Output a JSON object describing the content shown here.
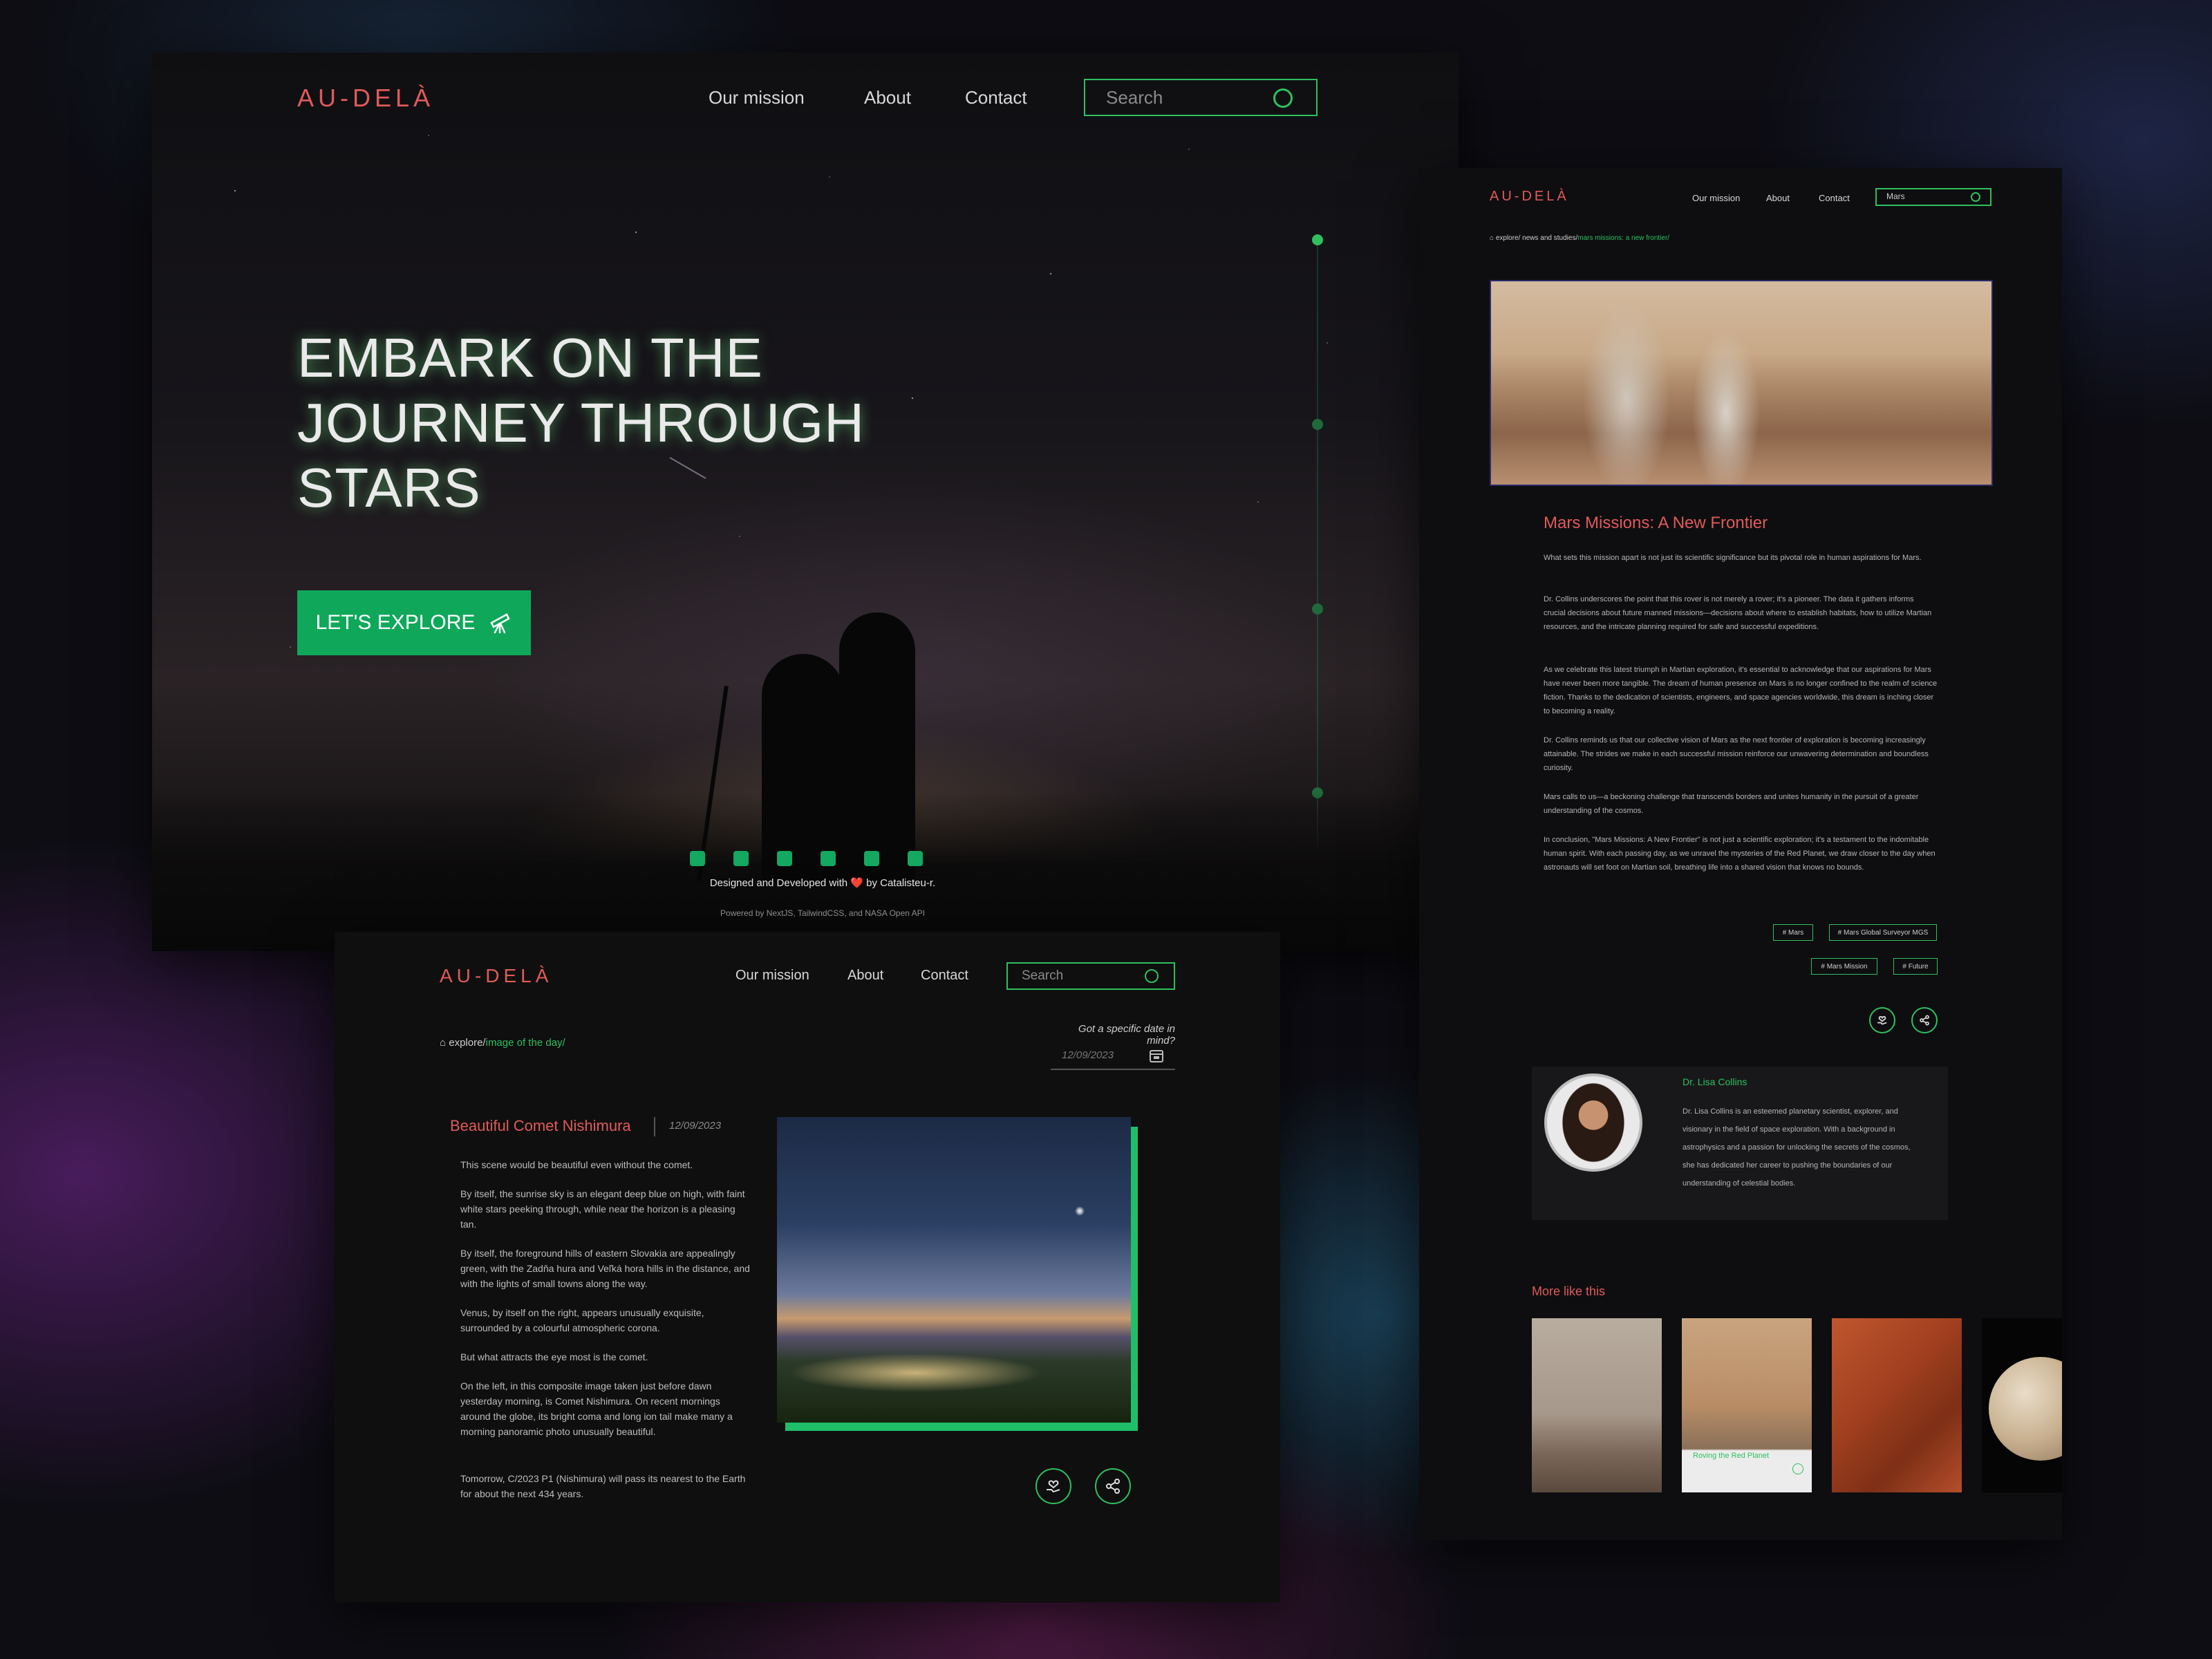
{
  "brand": "AU-DELÀ",
  "nav": [
    "Our mission",
    "About",
    "Contact"
  ],
  "hero": {
    "search_placeholder": "Search",
    "title": "EMBARK ON THE JOURNEY THROUGH STARS",
    "cta_label": "LET'S EXPLORE",
    "footer_line1": "Designed and Developed with ❤️ by Catalisteu-r.",
    "footer_line2": "Powered by NextJS, TailwindCSS, and NASA Open API",
    "social_icons": [
      "linkedin-icon",
      "github-icon",
      "dribbble-icon",
      "instagram-icon",
      "twitter-icon",
      "tumblr-icon"
    ]
  },
  "apod": {
    "search_placeholder": "Search",
    "breadcrumb_root": "explore/",
    "breadcrumb_current": "image of the day/",
    "date_prompt": "Got a specific date in mind?",
    "date_value": "12/09/2023",
    "post_title": "Beautiful Comet Nishimura",
    "post_date": "12/09/2023",
    "paragraphs": [
      "This scene would be beautiful even without the comet.",
      "By itself, the sunrise sky is an elegant deep blue on high, with faint white stars peeking through, while near the horizon is a pleasing tan.",
      "By itself, the foreground hills of eastern Slovakia are appealingly green, with the Zadňa hura and Veľká hora hills in the distance, and with the lights of small towns along the way.",
      "Venus, by itself on the right, appears unusually exquisite, surrounded by a colourful atmospheric corona.",
      "But what attracts the eye most is the comet.",
      "On the left, in this composite image taken just before dawn yesterday morning, is Comet Nishimura. On recent mornings around the globe, its bright coma and long ion tail make many a morning panoramic photo unusually beautiful.",
      "Tomorrow, C/2023 P1 (Nishimura) will pass its nearest to the Earth for about the next 434 years."
    ]
  },
  "article": {
    "search_value": "Mars",
    "breadcrumb_root": "explore/ news and studies/",
    "breadcrumb_current": "mars missions: a new frontier/",
    "title": "Mars Missions: A New Frontier",
    "paragraphs": [
      "What sets this mission apart is not just its scientific significance but its pivotal role in human aspirations for Mars.",
      "Dr. Collins underscores the point that this rover is not merely a rover; it's a pioneer. The data it gathers informs crucial decisions about future manned missions—decisions about where to establish habitats, how to utilize Martian resources, and the intricate planning required for safe and successful expeditions.",
      "As we celebrate this latest triumph in Martian exploration, it's essential to acknowledge that our aspirations for Mars have never been more tangible. The dream of human presence on Mars is no longer confined to the realm of science fiction. Thanks to the dedication of scientists, engineers, and space agencies worldwide, this dream is inching closer to becoming a reality.",
      "Dr. Collins reminds us that our collective vision of Mars as the next frontier of exploration is becoming increasingly attainable. The strides we make in each successful mission reinforce our unwavering determination and boundless curiosity.",
      "Mars calls to us—a beckoning challenge that transcends borders and unites humanity in the pursuit of a greater understanding of the cosmos.",
      "In conclusion, \"Mars Missions: A New Frontier\" is not just a scientific exploration; it's a testament to the indomitable human spirit. With each passing day, as we unravel the mysteries of the Red Planet, we draw closer to the day when astronauts will set foot on Martian soil, breathing life into a shared vision that knows no bounds."
    ],
    "tags": [
      "# Mars",
      "# Mars Global Surveyor MGS",
      "# Mars Mission",
      "# Future"
    ],
    "author_name": "Dr. Lisa Collins",
    "author_bio": "Dr. Lisa Collins is an esteemed planetary scientist, explorer, and visionary in the field of space exploration. With a background in astrophysics and a passion for unlocking the secrets of the cosmos, she has dedicated her career to pushing the boundaries of our understanding of celestial bodies.",
    "more_title": "More like this",
    "more_caption": "Roving the Red Planet"
  },
  "colors": {
    "brand": "#e05a5a",
    "accent": "#2fbf5f",
    "cta": "#0fa85a",
    "background": "#0f0f0f"
  }
}
